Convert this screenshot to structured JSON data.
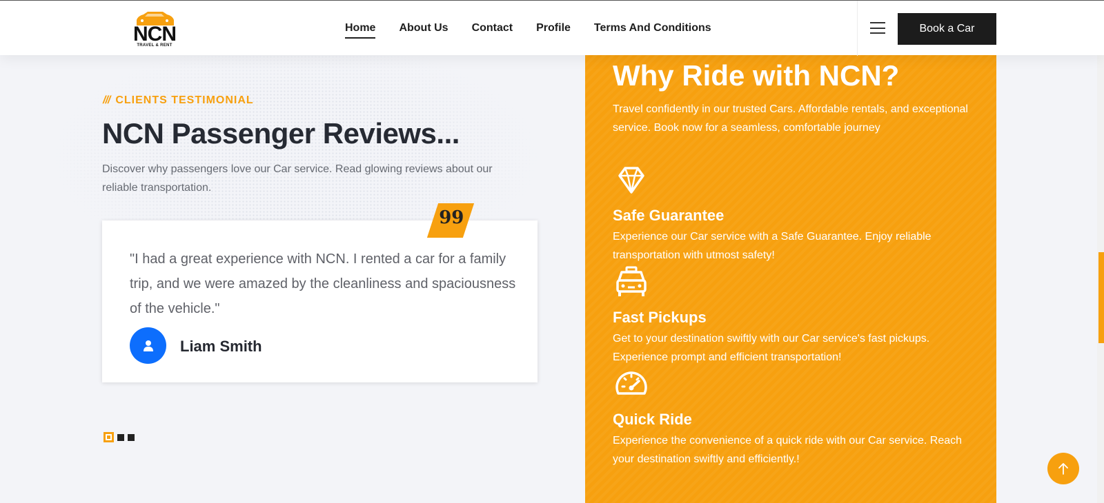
{
  "header": {
    "logo_word": "NCN",
    "logo_sub": "TRAVEL & RENT",
    "nav": [
      "Home",
      "About Us",
      "Contact",
      "Profile",
      "Terms And Conditions"
    ],
    "book_button": "Book a Car"
  },
  "testimonial": {
    "eyebrow": "CLIENTS TESTIMONIAL",
    "eyebrow_slashes": "///",
    "title": "NCN Passenger Reviews...",
    "description": "Discover why passengers love our Car service. Read glowing reviews about our reliable transportation.",
    "quote_mark": "99",
    "review": "\"I had a great experience with NCN. I rented a car for a family trip, and we were amazed by the cleanliness and spaciousness of the vehicle.\"",
    "reviewer": "Liam Smith",
    "slide_count": 3,
    "active_slide": 1
  },
  "why": {
    "title": "Why Ride with NCN?",
    "description": "Travel confidently in our trusted Cars. Affordable rentals, and exceptional service. Book now for a seamless, comfortable journey",
    "features": [
      {
        "icon": "diamond-icon",
        "title": "Safe Guarantee",
        "text": "Experience our Car service with a Safe Guarantee. Enjoy reliable transportation with utmost safety!"
      },
      {
        "icon": "taxi-icon",
        "title": "Fast Pickups",
        "text": "Get to your destination swiftly with our Car service's fast pickups. Experience prompt and efficient transportation!"
      },
      {
        "icon": "speedometer-icon",
        "title": "Quick Ride",
        "text": "Experience the convenience of a quick ride with our Car service. Reach your destination swiftly and efficiently.!"
      }
    ]
  },
  "colors": {
    "accent": "#f7a00f",
    "dark": "#1c1c1c",
    "avatar": "#0d6efd"
  }
}
